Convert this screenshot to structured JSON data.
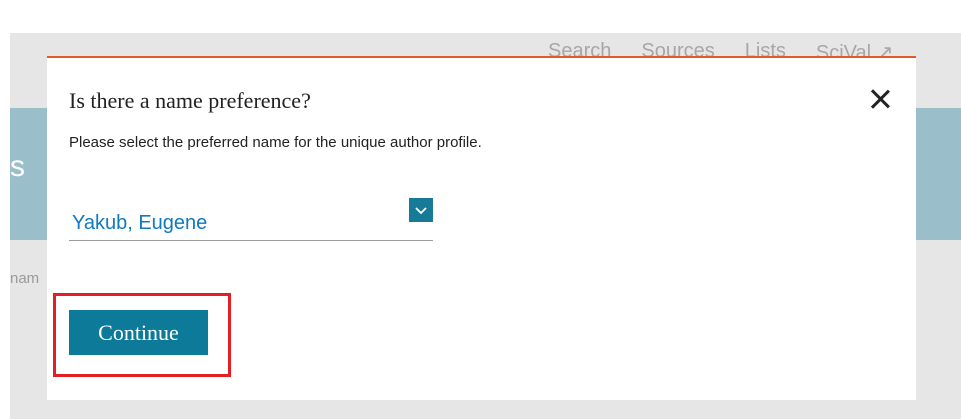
{
  "background": {
    "nav_items": [
      "Search",
      "Sources",
      "Lists",
      "SciVal ↗"
    ],
    "left_letter": "s",
    "left_fragment": "nam"
  },
  "dialog": {
    "title": "Is there a name preference?",
    "subtitle": "Please select the preferred name for the unique author profile.",
    "name_select": {
      "selected": "Yakub, Eugene",
      "icon": "chevron-down-icon"
    },
    "continue_label": "Continue",
    "close_icon": "close-icon"
  },
  "colors": {
    "accent_top_border": "#e05a2b",
    "primary_button": "#0c7a98",
    "link_blue": "#0d7ac1",
    "highlight_red": "#e31e24"
  }
}
